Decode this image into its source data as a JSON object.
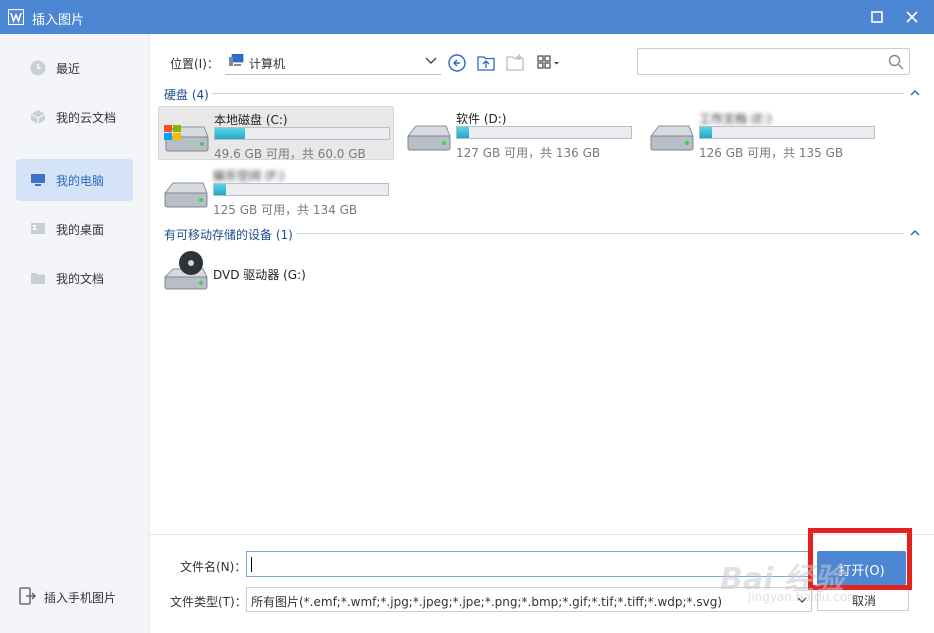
{
  "window": {
    "title": "插入图片",
    "colors": {
      "accent": "#4d86d3",
      "sidebar_bg": "#f3f5f8",
      "active_item": "#d5e3f6",
      "highlight": "#e42121"
    }
  },
  "sidebar": {
    "items": [
      {
        "label": "最近",
        "icon": "clock-icon"
      },
      {
        "label": "我的云文档",
        "icon": "cloud-doc-icon"
      },
      {
        "label": "我的电脑",
        "icon": "monitor-icon",
        "active": true
      },
      {
        "label": "我的桌面",
        "icon": "desktop-icon"
      },
      {
        "label": "我的文档",
        "icon": "folder-icon"
      }
    ],
    "bottom": {
      "label": "插入手机图片",
      "icon": "phone-import-icon"
    }
  },
  "toolbar": {
    "location_label": "位置(I)：",
    "location_value": "计算机"
  },
  "sections": [
    {
      "title": "硬盘 (4)"
    },
    {
      "title": "有可移动存储的设备 (1)"
    }
  ],
  "drives": [
    {
      "name": "本地磁盘 (C:)",
      "free": "49.6 GB 可用，共 60.0 GB",
      "used_fraction": 0.17
    },
    {
      "name": "软件 (D:)",
      "free": "127 GB 可用，共 136 GB",
      "used_fraction": 0.07
    },
    {
      "name": "工作文档 (E:)",
      "free": "126 GB 可用，共 135 GB",
      "used_fraction": 0.07
    },
    {
      "name": "娱乐空间 (F:)",
      "free": "125 GB 可用，共 134 GB",
      "used_fraction": 0.07
    }
  ],
  "removable": [
    {
      "name": "DVD 驱动器 (G:)"
    }
  ],
  "bottom": {
    "filename_label": "文件名(N)：",
    "filename_value": "",
    "filetype_label": "文件类型(T)：",
    "filetype_value": "所有图片(*.emf;*.wmf;*.jpg;*.jpeg;*.jpe;*.png;*.bmp;*.gif;*.tif;*.tiff;*.wdp;*.svg)",
    "open_label": "打开(O)",
    "cancel_label": "取消"
  },
  "watermark": {
    "line1": "Bai 经验",
    "line2": "jingyan.baidu.com"
  }
}
